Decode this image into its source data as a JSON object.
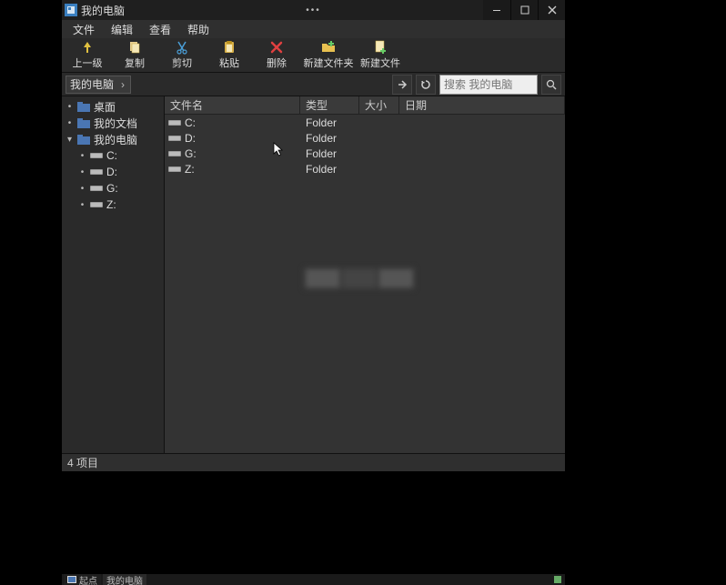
{
  "window": {
    "title": "我的电脑"
  },
  "menu": {
    "file": "文件",
    "edit": "编辑",
    "view": "查看",
    "help": "帮助"
  },
  "toolbar": {
    "up": "上一级",
    "copy": "复制",
    "cut": "剪切",
    "paste": "粘贴",
    "delete": "删除",
    "newfolder": "新建文件夹",
    "newfile": "新建文件"
  },
  "address": {
    "path": "我的电脑"
  },
  "search": {
    "placeholder": "搜索 我的电脑"
  },
  "sidebar": {
    "items": [
      {
        "label": "桌面",
        "icon": "folder",
        "indent": 0,
        "expander": "•"
      },
      {
        "label": "我的文档",
        "icon": "folder",
        "indent": 0,
        "expander": "•"
      },
      {
        "label": "我的电脑",
        "icon": "folder",
        "indent": 0,
        "expander": "▾"
      },
      {
        "label": "C:",
        "icon": "drive",
        "indent": 1,
        "expander": "•"
      },
      {
        "label": "D:",
        "icon": "drive",
        "indent": 1,
        "expander": "•"
      },
      {
        "label": "G:",
        "icon": "drive",
        "indent": 1,
        "expander": "•"
      },
      {
        "label": "Z:",
        "icon": "drive",
        "indent": 1,
        "expander": "•"
      }
    ]
  },
  "columns": {
    "name": "文件名",
    "type": "类型",
    "size": "大小",
    "date": "日期"
  },
  "files": [
    {
      "name": "C:",
      "type": "Folder",
      "size": "",
      "date": ""
    },
    {
      "name": "D:",
      "type": "Folder",
      "size": "",
      "date": ""
    },
    {
      "name": "G:",
      "type": "Folder",
      "size": "",
      "date": ""
    },
    {
      "name": "Z:",
      "type": "Folder",
      "size": "",
      "date": ""
    }
  ],
  "status": {
    "text": "4 项目"
  },
  "taskbar": {
    "start": "起点",
    "app": "我的电脑"
  }
}
